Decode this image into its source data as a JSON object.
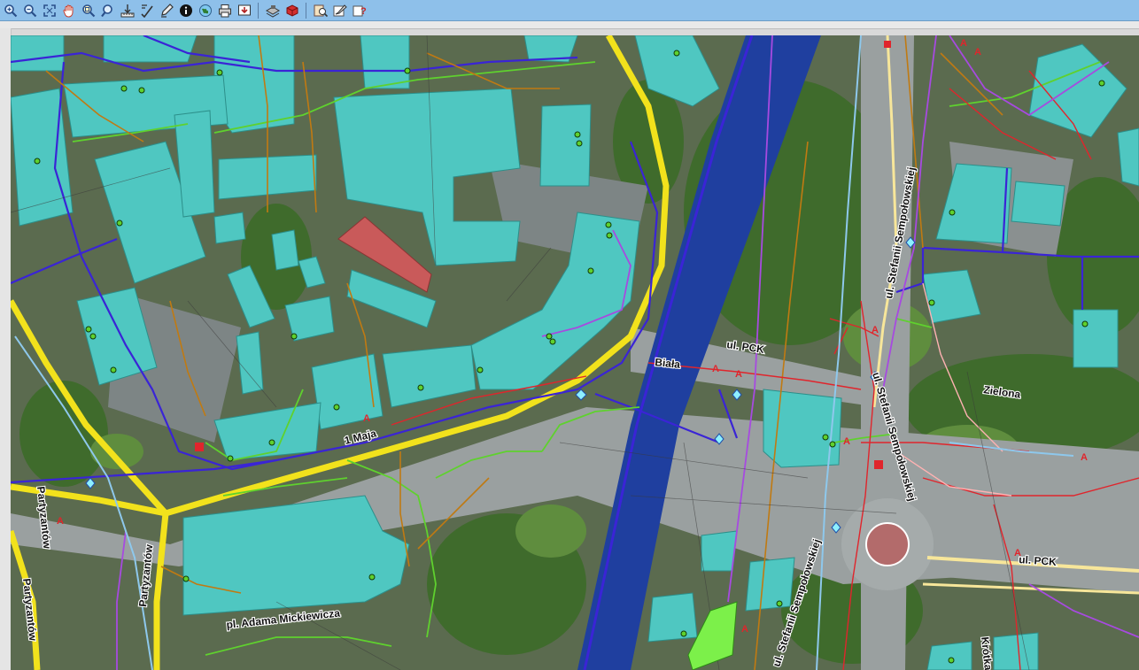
{
  "toolbar": {
    "buttons": [
      {
        "icon": "zoom-in-icon",
        "color": "#2a4f8a"
      },
      {
        "icon": "zoom-out-icon",
        "color": "#2a4f8a"
      },
      {
        "icon": "zoom-extent-icon",
        "color": "#2a4f8a"
      },
      {
        "icon": "pan-hand-icon",
        "color": "#c93c2a"
      },
      {
        "icon": "zoom-window-icon",
        "color": "#2a4f8a"
      },
      {
        "icon": "zoom-previous-icon",
        "color": "#2a4f8a"
      },
      {
        "icon": "measure-icon",
        "color": "#333333"
      },
      {
        "icon": "select-icon",
        "color": "#333333"
      },
      {
        "icon": "edit-icon",
        "color": "#333333"
      },
      {
        "icon": "info-icon",
        "color": "#111111"
      },
      {
        "icon": "globe-icon",
        "color": "#2e7d32"
      },
      {
        "icon": "print-icon",
        "color": "#333333"
      },
      {
        "icon": "export-icon",
        "color": "#b22222"
      },
      {
        "icon": "layers-icon",
        "color": "#333333"
      },
      {
        "icon": "database-icon",
        "color": "#c62828"
      },
      {
        "icon": "search-object-icon",
        "color": "#6d4c41"
      },
      {
        "icon": "settings-icon",
        "color": "#555555"
      },
      {
        "icon": "help-icon",
        "color": "#c62828"
      }
    ]
  },
  "map": {
    "colors": {
      "building": "#4fc7c1",
      "road_yellow": "#f2e21c",
      "river": "#1f3f9f",
      "water_line": "#3a24d6",
      "gas_line": "#5fd12e",
      "sewer_line": "#c07a12",
      "power_line": "#e0252c",
      "telecom_line": "#a74ae0",
      "heating_line": "#ffb2b2"
    },
    "street_labels": {
      "pck_1": "ul. PCK",
      "pck_2": "ul. PCK",
      "biala": "Biała",
      "zielona": "Zielona",
      "maja": "1 Maja",
      "partyzantow_1": "Partyzantów",
      "partyzantow_2": "Partyzantów",
      "partyzantow_3": "Partyzantów",
      "sempolowskiej_1": "ul. Stefanii Sempołowskiej",
      "sempolowskiej_2": "ul. Stefanii Sempołowskiej",
      "sempolowskiej_3": "ul. Stefanii Sempołowskiej",
      "mickiewicza": "pl. Adama Mickiewicza",
      "krotka": "Krótka"
    }
  }
}
